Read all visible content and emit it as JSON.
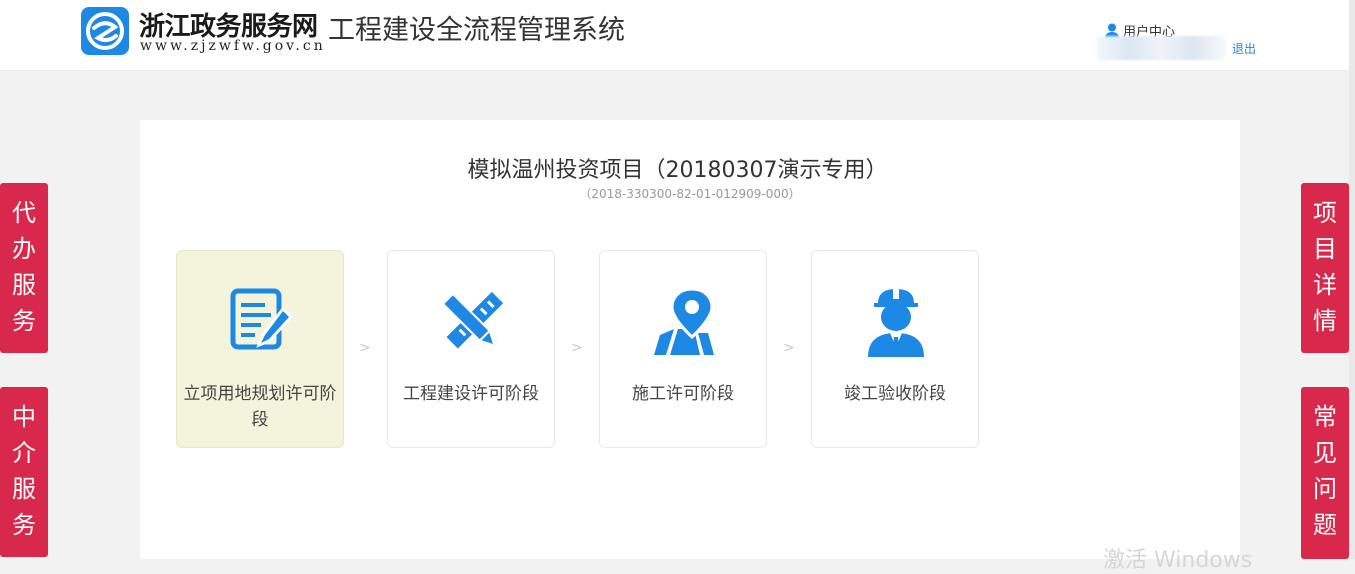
{
  "header": {
    "site_name": "浙江政务服务网",
    "system_name": "工程建设全流程管理系统",
    "site_url": "www.zjzwfw.gov.cn",
    "user_center": "用户中心",
    "logout": "退出"
  },
  "project": {
    "title": "模拟温州投资项目（20180307演示专用）",
    "code": "（2018-330300-82-01-012909-000）"
  },
  "stages": [
    {
      "label": "立项用地规划许可阶段",
      "icon": "document-pen-icon"
    },
    {
      "label": "工程建设许可阶段",
      "icon": "ruler-pencil-icon"
    },
    {
      "label": "施工许可阶段",
      "icon": "map-pin-icon"
    },
    {
      "label": "竣工验收阶段",
      "icon": "worker-helmet-icon"
    }
  ],
  "arrow": ">",
  "side_left": [
    {
      "label": "代办服务"
    },
    {
      "label": "中介服务"
    }
  ],
  "side_right": [
    {
      "label": "项目详情"
    },
    {
      "label": "常见问题"
    }
  ],
  "watermark": "激活 Windows",
  "colors": {
    "accent": "#1e88e5",
    "side_tab": "#d8284b",
    "active_card": "#f4f4dc"
  }
}
